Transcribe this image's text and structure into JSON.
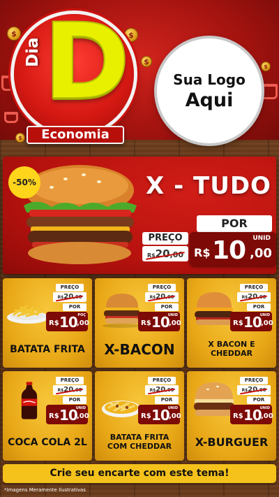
{
  "header": {
    "badge": {
      "dia": "Dia",
      "letter": "D",
      "ribbon": "Economia"
    },
    "logo_placeholder": {
      "line1": "Sua Logo",
      "line2": "Aqui"
    },
    "coin_symbol": "$"
  },
  "hero": {
    "discount": "-50%",
    "name": "X - TUDO",
    "por_label": "POR",
    "preco_label": "PREÇO",
    "old_currency": "R$",
    "old_int": "20",
    "old_cents": ",00",
    "unit_label": "UNID",
    "currency": "R$",
    "price_int": "10",
    "price_cents": ",00"
  },
  "products": [
    {
      "name": "BATATA FRITA",
      "unit_label": "POÇ",
      "icon": "fries-icon"
    },
    {
      "name": "X-BACON",
      "unit_label": "UNID",
      "icon": "burger-icon"
    },
    {
      "name": "X BACON E CHEDDAR",
      "unit_label": "UNID",
      "icon": "burger-icon"
    },
    {
      "name": "COCA COLA 2L",
      "unit_label": "UNID",
      "icon": "soda-bottle-icon"
    },
    {
      "name": "BATATA FRITA COM CHEDDAR",
      "unit_label": "UNID",
      "icon": "fries-cheddar-icon"
    },
    {
      "name": "X-BURGUER",
      "unit_label": "UNID",
      "icon": "burger-icon"
    }
  ],
  "card_prices": {
    "preco_label": "PREÇO",
    "old_currency": "R$",
    "old_int": "20",
    "old_cents": ",00",
    "por_label": "POR",
    "currency": "R$",
    "price_int": "10",
    "price_cents": ",00"
  },
  "footer": {
    "cta": "Crie seu encarte com este tema!",
    "disclaimer": "*Imagens Meramente Ilustrativas"
  },
  "colors": {
    "header_red": "#b7120e",
    "badge_yellow": "#e8f000",
    "card_yellow": "#eeb020",
    "price_dark_red": "#7d0a07",
    "cta_yellow": "#f5c21c",
    "wood_brown": "#5b3216"
  }
}
